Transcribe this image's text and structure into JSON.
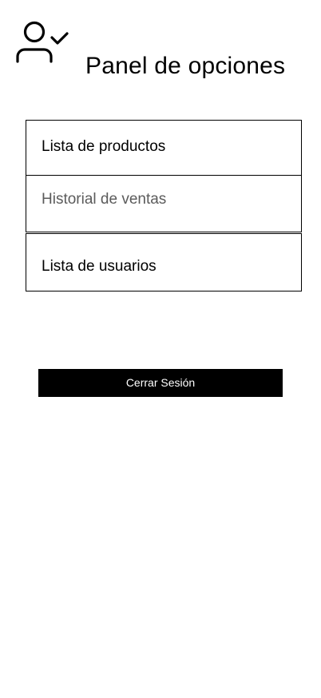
{
  "header": {
    "icon": "user-check-icon",
    "title": "Panel de opciones"
  },
  "menu": {
    "items": [
      {
        "label": "Lista de productos"
      },
      {
        "label": "Historial de ventas"
      },
      {
        "label": "Lista de usuarios"
      }
    ]
  },
  "actions": {
    "logout_label": "Cerrar Sesión"
  },
  "colors": {
    "background": "#ffffff",
    "text": "#000000",
    "muted_text": "#5b5b5b",
    "button_background": "#000000",
    "button_text": "#ffffff"
  }
}
